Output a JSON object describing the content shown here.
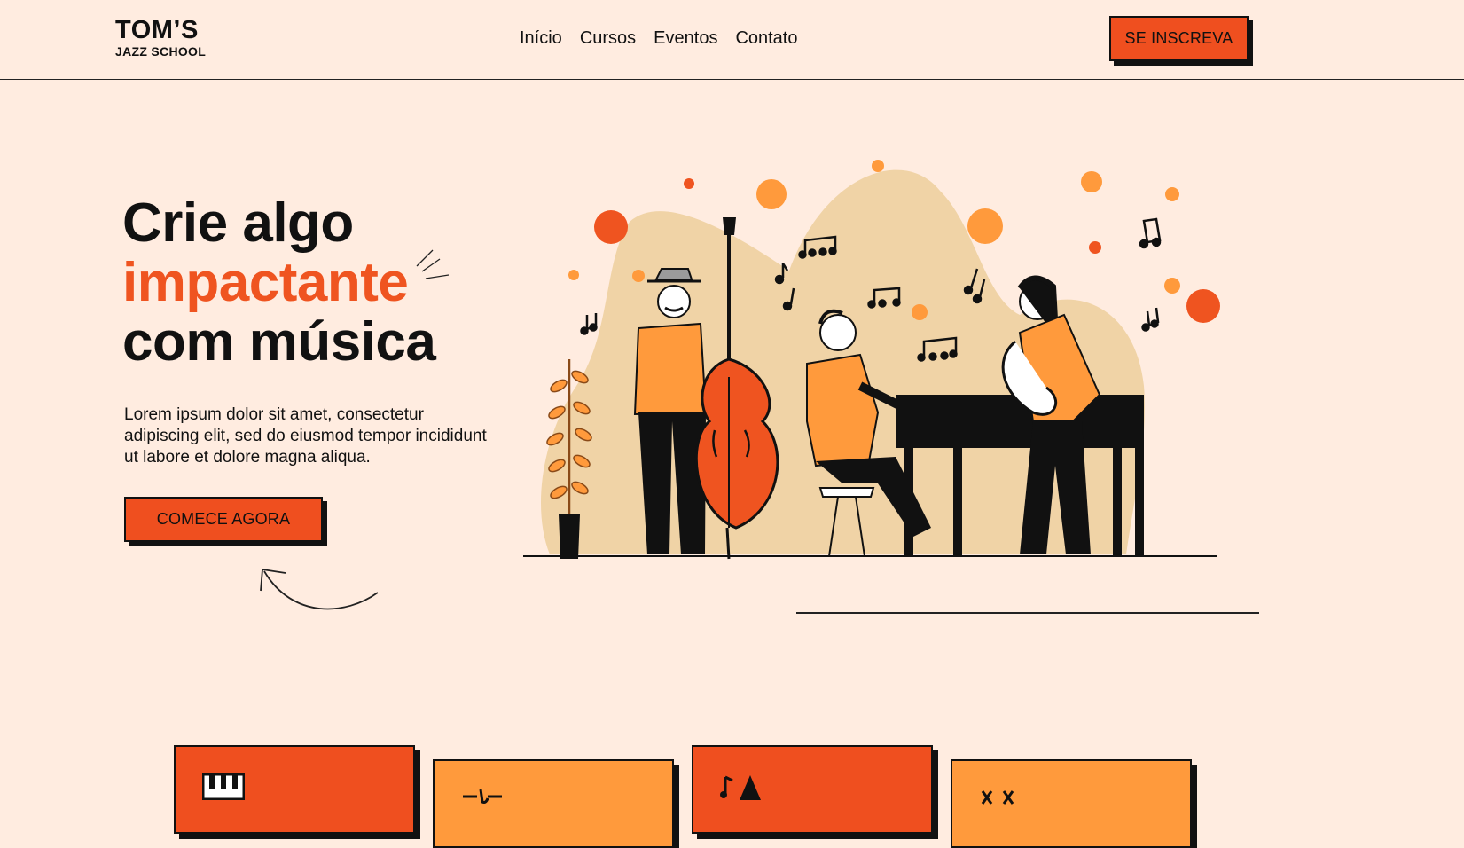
{
  "header": {
    "logo": {
      "main": "TOM’S",
      "sub": "JAZZ SCHOOL"
    },
    "nav": [
      "Início",
      "Cursos",
      "Eventos",
      "Contato"
    ],
    "cta_label": "SE INSCREVA"
  },
  "hero": {
    "title_line1": "Crie algo",
    "title_accent": "impactante",
    "title_line3": "com música",
    "text": "Lorem ipsum dolor sit amet, consectetur adipiscing elit, sed do eiusmod tempor incididunt ut labore et dolore magna aliqua.",
    "cta_label": "COMECE AGORA",
    "illustration_icon": "jazz-band-illustration"
  },
  "cards": [
    {
      "icon": "piano-keys-icon",
      "color": "#ef4f1f"
    },
    {
      "icon": "music-stroke-icon",
      "color": "#ff9a3c"
    },
    {
      "icon": "music-notes-icon",
      "color": "#ef4f1f"
    },
    {
      "icon": "drumsticks-icon",
      "color": "#ff9a3c"
    }
  ],
  "colors": {
    "background": "#ffece0",
    "accent": "#ef5420",
    "accent_light": "#ff9a3c",
    "blob": "#f0d3a6"
  }
}
